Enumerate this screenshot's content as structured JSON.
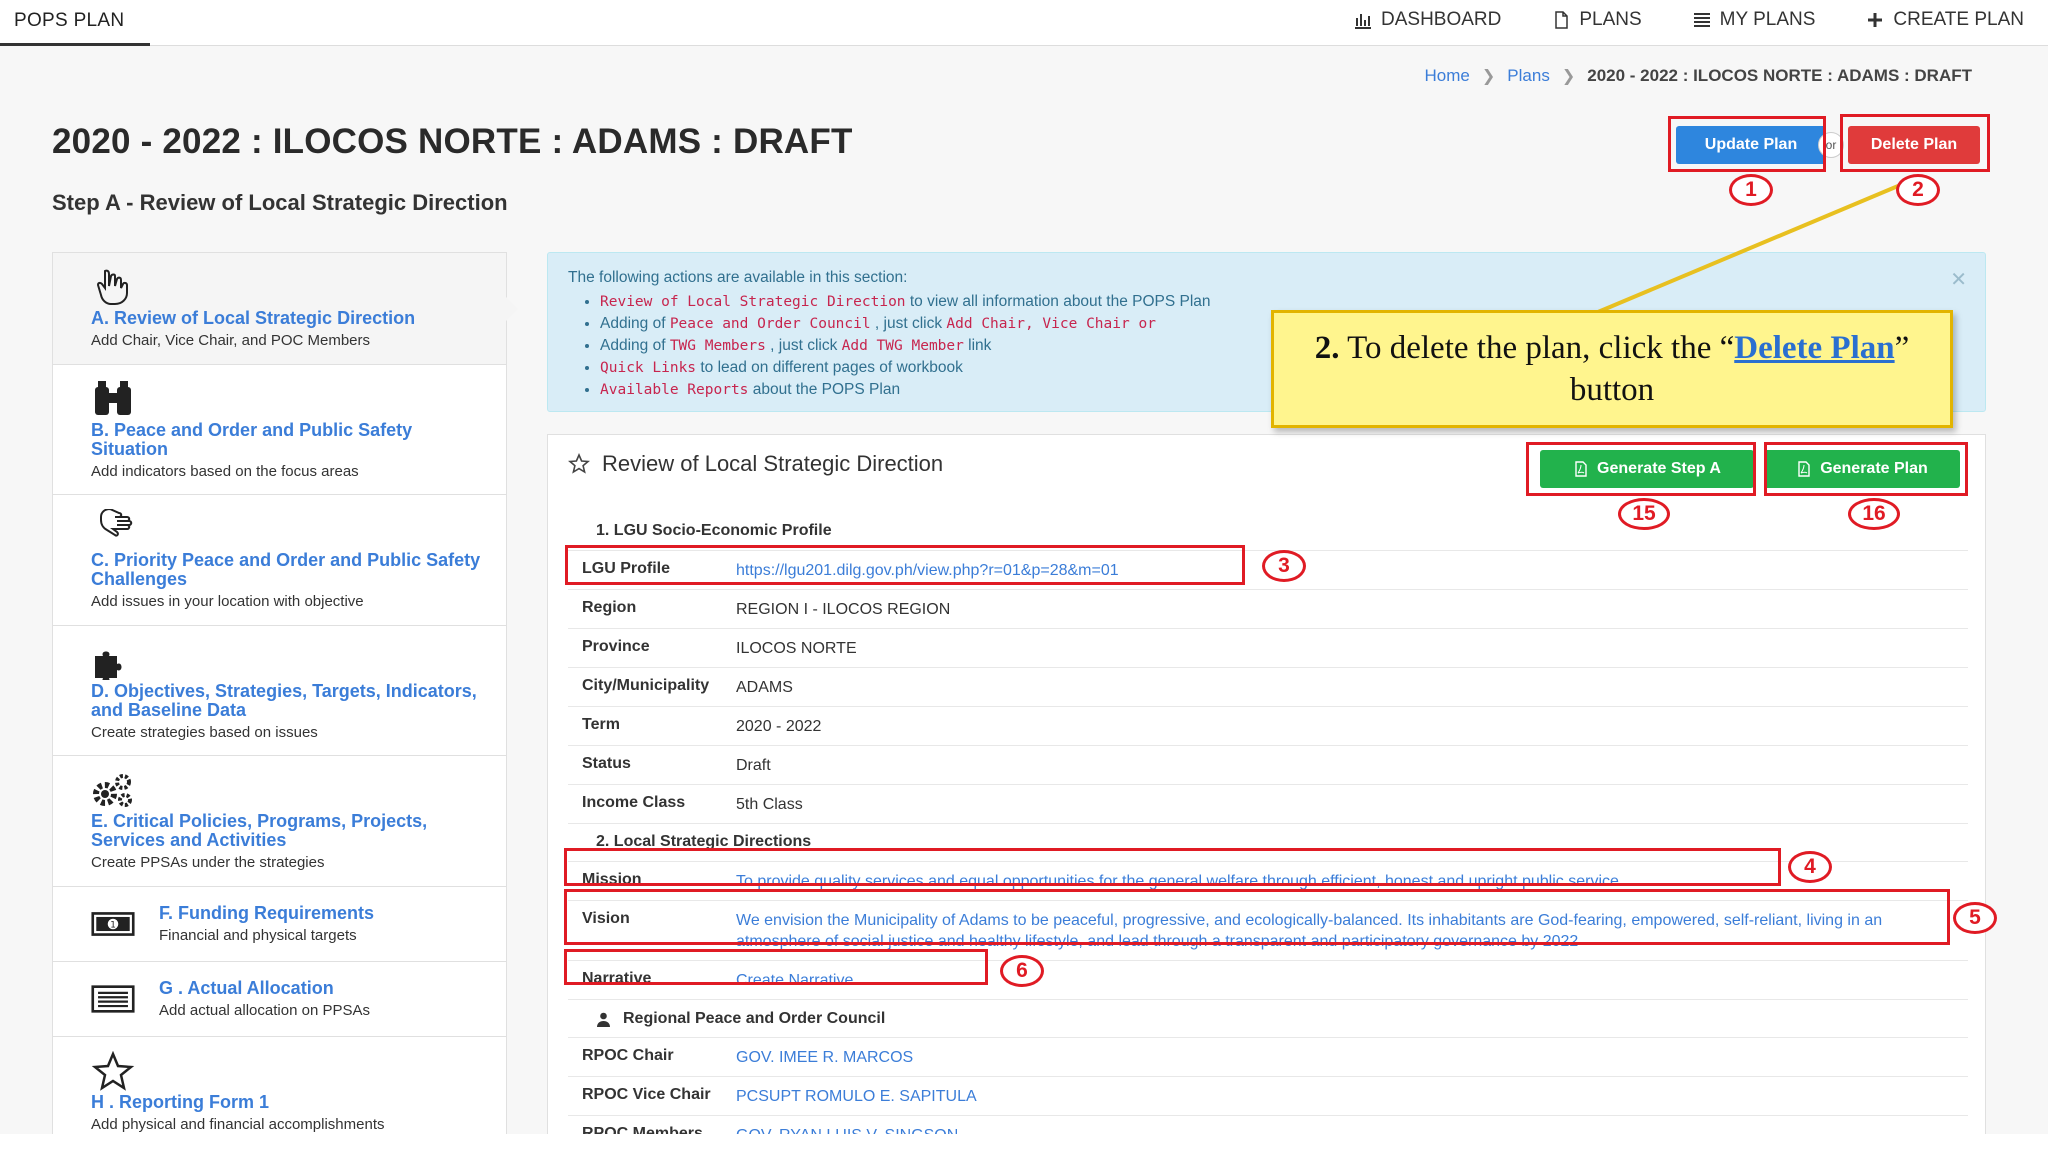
{
  "nav": {
    "brand": "POPS PLAN",
    "links": [
      {
        "label": "DASHBOARD",
        "icon": "bar-chart-icon"
      },
      {
        "label": "PLANS",
        "icon": "file-icon"
      },
      {
        "label": "MY PLANS",
        "icon": "list-icon"
      },
      {
        "label": "CREATE PLAN",
        "icon": "plus-icon"
      }
    ]
  },
  "breadcrumb": {
    "home": "Home",
    "plans": "Plans",
    "current": "2020 - 2022 : ILOCOS NORTE : ADAMS : DRAFT"
  },
  "page": {
    "title": "2020 - 2022 : ILOCOS NORTE : ADAMS : DRAFT",
    "step": "Step A - Review of Local Strategic Direction"
  },
  "actions": {
    "update": "Update Plan",
    "or": "or",
    "delete": "Delete Plan",
    "generate_step": "Generate Step A",
    "generate_plan": "Generate Plan"
  },
  "annotations": [
    "1",
    "2",
    "3",
    "4",
    "5",
    "6",
    "15",
    "16"
  ],
  "callout": {
    "number": "2.",
    "text_before": "To delete the plan, click the “",
    "link": "Delete Plan",
    "text_after": "” button"
  },
  "sidebar": [
    {
      "title": "A. Review of Local Strategic Direction",
      "sub": "Add Chair, Vice Chair, and POC Members",
      "icon": "hand-pointer-icon"
    },
    {
      "title": "B. Peace and Order and Public Safety Situation",
      "sub": "Add indicators based on the focus areas",
      "icon": "binoculars-icon"
    },
    {
      "title": "C. Priority Peace and Order and Public Safety Challenges",
      "sub": "Add issues in your location with objective",
      "icon": "hand-paper-icon"
    },
    {
      "title": "D. Objectives, Strategies, Targets, Indicators, and Baseline Data",
      "sub": "Create strategies based on issues",
      "icon": "puzzle-icon"
    },
    {
      "title": "E. Critical Policies, Programs, Projects, Services and Activities",
      "sub": "Create PPSAs under the strategies",
      "icon": "gears-icon"
    },
    {
      "title": "F. Funding Requirements",
      "sub": "Financial and physical targets",
      "icon": "money-icon"
    },
    {
      "title": "G . Actual Allocation",
      "sub": "Add actual allocation on PPSAs",
      "icon": "list-alt-icon"
    },
    {
      "title": "H . Reporting Form 1",
      "sub": "Add physical and financial accomplishments",
      "icon": "star-icon"
    }
  ],
  "alert": {
    "intro": "The following actions are available in this section:",
    "items": [
      {
        "code": "Review of Local Strategic Direction",
        "text": " to view all information about the POPS Plan"
      },
      {
        "pre": "Adding of ",
        "code": "Peace and Order Council",
        "text": " , just click ",
        "code2": "Add Chair, Vice Chair or"
      },
      {
        "pre": "Adding of ",
        "code": "TWG Members",
        "text": " , just click ",
        "code2": "Add TWG Member",
        "post": " link"
      },
      {
        "code": "Quick Links",
        "text": " to lead on different pages of workbook"
      },
      {
        "code": "Available Reports",
        "text": " about the POPS Plan"
      }
    ]
  },
  "panel": {
    "title": "Review of Local Strategic Direction",
    "section1": "1. LGU Socio-Economic Profile",
    "section2": "2. Local Strategic Directions",
    "section3": "Regional Peace and Order Council",
    "rows1": [
      {
        "k": "LGU Profile",
        "v": "https://lgu201.dilg.gov.ph/view.php?r=01&p=28&m=01",
        "link": true
      },
      {
        "k": "Region",
        "v": "REGION I - ILOCOS REGION"
      },
      {
        "k": "Province",
        "v": "ILOCOS NORTE"
      },
      {
        "k": "City/Municipality",
        "v": "ADAMS"
      },
      {
        "k": "Term",
        "v": "2020 - 2022"
      },
      {
        "k": "Status",
        "v": "Draft"
      },
      {
        "k": "Income Class",
        "v": "5th Class"
      }
    ],
    "rows2": [
      {
        "k": "Mission",
        "v": "To provide quality services and equal opportunities for the general welfare through efficient, honest and upright public service ."
      },
      {
        "k": "Vision",
        "v": "We envision the Municipality of Adams to be peaceful, progressive, and ecologically-balanced. Its inhabitants are God-fearing, empowered, self-reliant, living in an atmosphere of social justice and healthy lifestyle, and lead through a transparent and participatory governance by 2022"
      },
      {
        "k": "Narrative",
        "v": "Create Narrative"
      }
    ],
    "rows3": [
      {
        "k": "RPOC Chair",
        "v": "GOV. IMEE R. MARCOS"
      },
      {
        "k": "RPOC Vice Chair",
        "v": "PCSUPT ROMULO E. SAPITULA"
      },
      {
        "k": "RPOC Members",
        "v": "GOV. RYAN LUIS V. SINGSON"
      }
    ]
  }
}
